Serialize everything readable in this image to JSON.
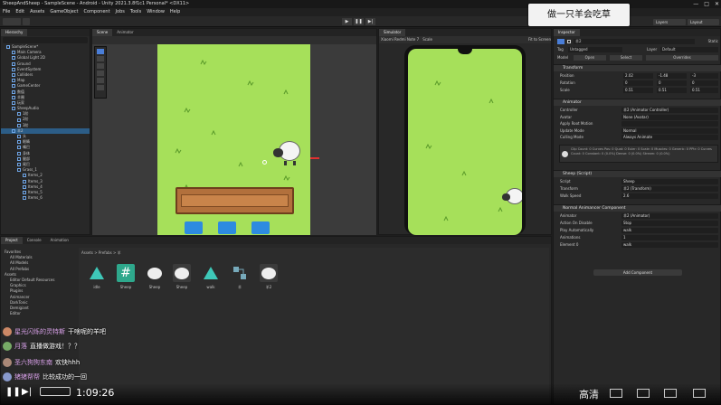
{
  "window": {
    "title": "SheepAndSheep - SampleScene - Android - Unity 2021.3.8f1c1 Personal* <DX11>",
    "min": "—",
    "max": "□",
    "close": "✕"
  },
  "menu": [
    "File",
    "Edit",
    "Assets",
    "GameObject",
    "Component",
    "Jobs",
    "Tools",
    "Window",
    "Help"
  ],
  "toolbar": {
    "play": "▶",
    "pause": "❚❚",
    "step": "▶|",
    "layers": "Layers",
    "layout": "Layout"
  },
  "caption": "做一只羊会吃草",
  "hierarchy": {
    "tab": "Hierarchy",
    "items": [
      {
        "label": "SampleScene*",
        "indent": 1
      },
      {
        "label": "Main Camera",
        "indent": 2
      },
      {
        "label": "Global Light 2D",
        "indent": 2
      },
      {
        "label": "Ground",
        "indent": 2
      },
      {
        "label": "EventSystem",
        "indent": 2
      },
      {
        "label": "Colliders",
        "indent": 2
      },
      {
        "label": "Map",
        "indent": 2
      },
      {
        "label": "GameCenter",
        "indent": 2
      },
      {
        "label": "数值",
        "indent": 2
      },
      {
        "label": "羊圈",
        "indent": 2
      },
      {
        "label": "玩家",
        "indent": 2
      },
      {
        "label": "SheepAudio",
        "indent": 2
      },
      {
        "label": "1阶",
        "indent": 3
      },
      {
        "label": "2阶",
        "indent": 3
      },
      {
        "label": "3阶",
        "indent": 3
      },
      {
        "label": "羊2",
        "indent": 2
      },
      {
        "label": "头",
        "indent": 3
      },
      {
        "label": "眼睛",
        "indent": 3
      },
      {
        "label": "嘴巴",
        "indent": 3
      },
      {
        "label": "身体",
        "indent": 3
      },
      {
        "label": "腿部",
        "indent": 3
      },
      {
        "label": "尾巴",
        "indent": 3
      },
      {
        "label": "Grass_1",
        "indent": 3
      },
      {
        "label": "Items_2",
        "indent": 4
      },
      {
        "label": "Items_3",
        "indent": 4
      },
      {
        "label": "Items_4",
        "indent": 4
      },
      {
        "label": "Items_5",
        "indent": 4
      },
      {
        "label": "Items_6",
        "indent": 4
      }
    ]
  },
  "scene": {
    "tab": "Scene",
    "tab2": "Animator"
  },
  "simulator": {
    "tab": "Simulator",
    "device": "Xiaomi Redmi Note 7",
    "scale": "Scale",
    "fit": "Fit to Screen"
  },
  "inspector": {
    "tab": "Inspector",
    "object_name": "羊2",
    "static": "Static",
    "tag": "Untagged",
    "layer": "Default",
    "prefab": {
      "label": "Model",
      "open": "Open",
      "select": "Select",
      "overrides": "Overrides"
    },
    "transform": {
      "title": "Transform",
      "position": {
        "label": "Position",
        "x": "2.02",
        "y": "-1.48",
        "z": "-3"
      },
      "rotation": {
        "label": "Rotation",
        "x": "0",
        "y": "0",
        "z": "0"
      },
      "scale": {
        "label": "Scale",
        "x": "0.51",
        "y": "0.51",
        "z": "0.51"
      }
    },
    "animator": {
      "title": "Animator",
      "rows": [
        {
          "label": "Controller",
          "value": "羊2 (Animator Controller)"
        },
        {
          "label": "Avatar",
          "value": "None (Avatar)"
        },
        {
          "label": "Apply Root Motion",
          "value": ""
        },
        {
          "label": "Update Mode",
          "value": "Normal"
        },
        {
          "label": "Culling Mode",
          "value": "Always Animate"
        }
      ],
      "info": "Clip Count: 0  Curves Pos: 0 Quat: 0 Euler: 0 Scale: 0 Muscles: 0 Generic: 0 PPtr: 0  Curves Count: 0 Constant: 0 (0.0%) Dense: 0 (0.0%) Stream: 0 (0.0%)"
    },
    "sheep_script": {
      "title": "Sheep (Script)",
      "rows": [
        {
          "label": "Script",
          "value": "Sheep"
        },
        {
          "label": "Transform",
          "value": "羊2 (Transform)"
        },
        {
          "label": "Walk Speed",
          "value": "2.6"
        }
      ]
    },
    "normal_anim": {
      "title": "Normal Animancer Component",
      "rows": [
        {
          "label": "Animator",
          "value": "羊2 (Animator)"
        },
        {
          "label": "Action On Disable",
          "value": "Stop"
        },
        {
          "label": "Play Automatically",
          "value": "walk"
        },
        {
          "label": "Animations",
          "value": "1"
        },
        {
          "label": "Element 0",
          "value": "walk"
        }
      ]
    },
    "add_component": "Add Component"
  },
  "project": {
    "tabs": [
      "Project",
      "Console",
      "Animation"
    ],
    "breadcrumb": "Assets > Prefabs > 羊",
    "tree": [
      "Favorites",
      "All Materials",
      "All Models",
      "All Prefabs",
      "Assets",
      "Editor Default Resources",
      "Graphics",
      "Plugins",
      "Animancer",
      "DarkTonic",
      "Demigiant",
      "Editor"
    ],
    "assets": [
      {
        "label": "idle",
        "icon": "animation-clip-icon"
      },
      {
        "label": "Sheep",
        "icon": "script-icon"
      },
      {
        "label": "Sheep",
        "icon": "sheep-prefab-icon"
      },
      {
        "label": "Sheep",
        "icon": "sheep-prefab-icon"
      },
      {
        "label": "walk",
        "icon": "animation-clip-icon"
      },
      {
        "label": "羊",
        "icon": "animator-controller-icon"
      },
      {
        "label": "羊2",
        "icon": "sheep-prefab-icon"
      }
    ]
  },
  "chat": [
    {
      "user": "星光闪烁的灵特斯",
      "text": "干啥呢的羊吧",
      "color": "#c86"
    },
    {
      "user": "月落",
      "text": "直播做游戏！？？",
      "color": "#7a6"
    },
    {
      "user": "圣六狗狗东南",
      "text": "欢快hhh",
      "color": "#a87"
    },
    {
      "user": "猪猪帮帮",
      "text": "比较成功的一回",
      "color": "#89c"
    }
  ],
  "video": {
    "time": "1:09:26",
    "quality": "高清"
  },
  "colors": {
    "grass": "#a6e05a",
    "accent": "#3d6ac8",
    "panel": "#282828"
  }
}
